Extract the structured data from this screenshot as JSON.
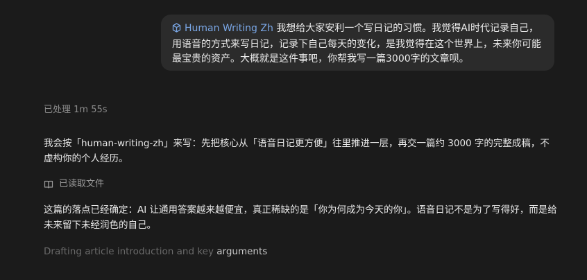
{
  "user_message": {
    "skill_chip_label": "Human Writing Zh",
    "skill_chip_icon": "cube-icon",
    "text": "我想给大家安利一个写日记的习惯。我觉得AI时代记录自己，用语音的方式来写日记，记录下自己每天的变化，是我觉得在这个世界上，未来你可能最宝贵的资产。大概就是这件事吧，你帮我写一篇3000字的文章呗。"
  },
  "assistant": {
    "status": "已处理 1m 55s",
    "paragraph_1": "我会按「human-writing-zh」来写：先把核心从「语音日记更方便」往里推进一层，再交一篇约 3000 字的完整成稿，不虚构你的个人经历。",
    "tool_action": {
      "icon": "book-open-icon",
      "label": "已读取文件"
    },
    "paragraph_2": "这篇的落点已经确定：AI 让通用答案越来越便宜，真正稀缺的是「你为何成为今天的你」。语音日记不是为了写得好，而是给未来留下未经润色的自己。",
    "drafting_prefix": "Drafting article introduction and key ",
    "drafting_suffix": "arguments"
  },
  "colors": {
    "background": "#1b1b1b",
    "bubble": "#2b2b2b",
    "chip_accent": "#7aa7e6",
    "muted_text": "#8a8a8a"
  }
}
